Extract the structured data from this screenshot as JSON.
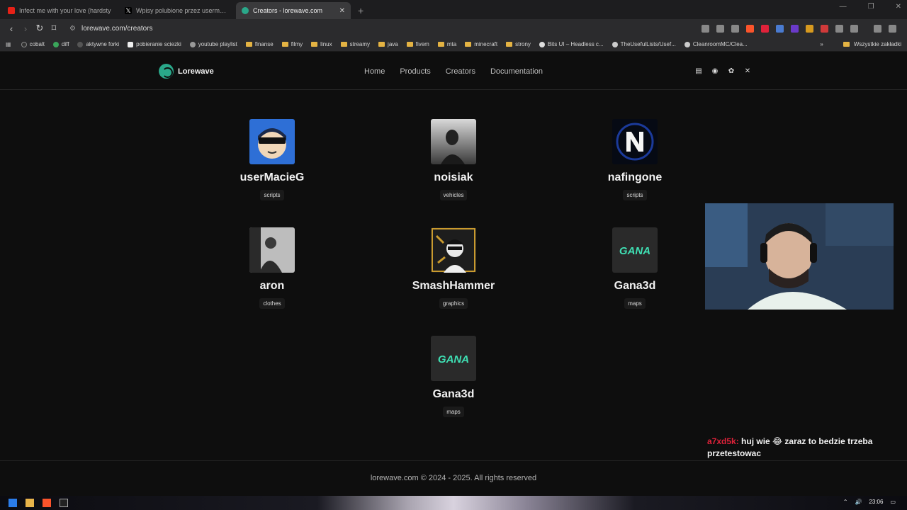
{
  "browser": {
    "tabs": [
      {
        "title": "Infect me with your love (hardsty",
        "active": false
      },
      {
        "title": "Wpisy polubione przez usermacieg (",
        "active": false
      },
      {
        "title": "Creators - lorewave.com",
        "active": true
      }
    ],
    "url": "lorewave.com/creators",
    "bookmarks": [
      "cobalt",
      "diff",
      "aktywne forki",
      "pobieranie sciezki",
      "youtube playlist",
      "finanse",
      "filmy",
      "linux",
      "streamy",
      "java",
      "fivem",
      "mta",
      "minecraft",
      "strony",
      "Bits UI – Headless c...",
      "TheUsefulLists/Usef...",
      "CleanroomMC/Clea..."
    ],
    "bookmarks_other": "Wszystkie zakładki"
  },
  "site": {
    "brand": "Lorewave",
    "nav": [
      "Home",
      "Products",
      "Creators",
      "Documentation"
    ],
    "creators": [
      {
        "name": "userMacieG",
        "tag": "scripts",
        "avatar": "cartoon-avatar"
      },
      {
        "name": "noisiak",
        "tag": "vehicles",
        "avatar": "photo-avatar"
      },
      {
        "name": "nafingone",
        "tag": "scripts",
        "avatar": "n-logo-avatar"
      },
      {
        "name": "aron",
        "tag": "clothes",
        "avatar": "photo-avatar"
      },
      {
        "name": "SmashHammer",
        "tag": "graphics",
        "avatar": "illustration-avatar"
      },
      {
        "name": "Gana3d",
        "tag": "maps",
        "avatar": "gana-logo-avatar"
      },
      {
        "name": "Gana3d",
        "tag": "maps",
        "avatar": "gana-logo-avatar"
      }
    ],
    "gana_logo_text": "GANA",
    "footer": "lorewave.com © 2024 - 2025. All rights reserved"
  },
  "overlay": {
    "chat_user": "a7xd5k:",
    "chat_message": "huj wie 😂 zaraz to bedzie trzeba przetestowac"
  },
  "taskbar": {
    "clock": "23:06"
  }
}
